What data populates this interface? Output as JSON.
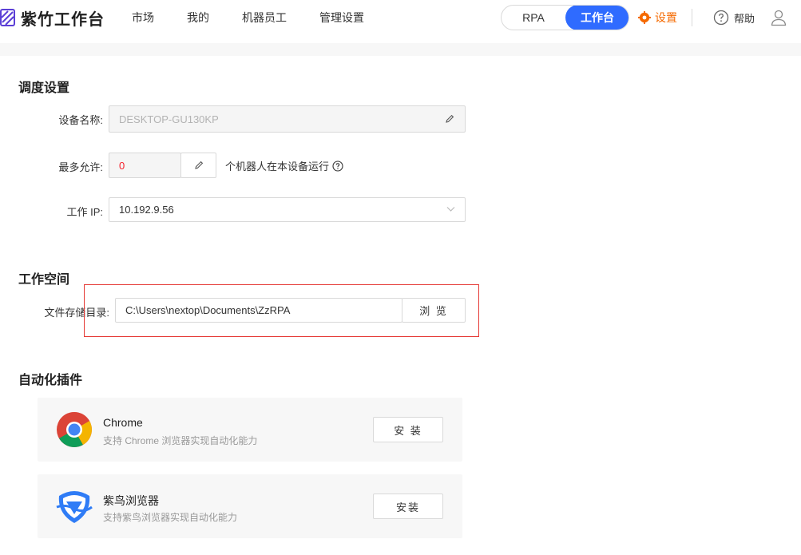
{
  "header": {
    "app_title": "紫竹工作台",
    "nav": [
      "市场",
      "我的",
      "机器员工",
      "管理设置"
    ],
    "segment": {
      "options": [
        "RPA",
        "工作台"
      ],
      "active_index": 1
    },
    "settings_label": "设置",
    "help_label": "帮助"
  },
  "schedule": {
    "title": "调度设置",
    "device_name_label": "设备名称:",
    "device_name_value": "DESKTOP-GU130KP",
    "max_allow_label": "最多允许:",
    "max_allow_value": "0",
    "max_allow_suffix": "个机器人在本设备运行",
    "work_ip_label": "工作 IP:",
    "work_ip_value": "10.192.9.56"
  },
  "workspace": {
    "title": "工作空间",
    "storage_label": "文件存储目录:",
    "storage_path": "C:\\Users\\nextop\\Documents\\ZzRPA",
    "browse_label": "浏 览"
  },
  "plugins": {
    "title": "自动化插件",
    "items": [
      {
        "name": "Chrome",
        "desc": "支持 Chrome 浏览器实现自动化能力",
        "button": "安 装",
        "icon": "chrome-icon"
      },
      {
        "name": "紫鸟浏览器",
        "desc": "支持紫鸟浏览器实现自动化能力",
        "button": "安装",
        "icon": "ziniao-browser-icon"
      }
    ]
  },
  "colors": {
    "accent_blue": "#2f6bff",
    "settings_orange": "#f56a00",
    "highlight_red": "#e53935",
    "value_red": "#f5222d"
  }
}
